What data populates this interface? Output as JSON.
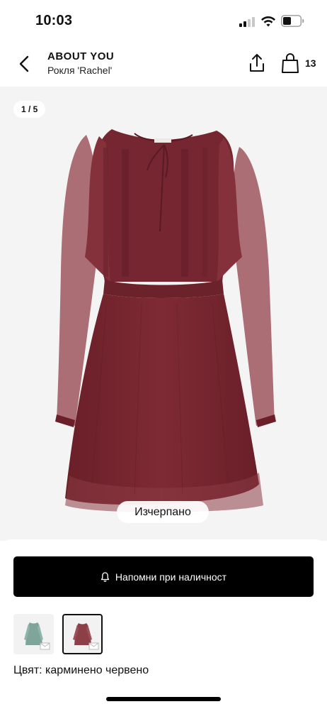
{
  "status_bar": {
    "time": "10:03"
  },
  "header": {
    "brand": "ABOUT YOU",
    "product_name": "Рокля 'Rachel'",
    "bag_count": "13",
    "icons": [
      "chevron-left-icon",
      "share-icon",
      "shopping-bag-icon"
    ]
  },
  "gallery": {
    "page_indicator": "1 / 5",
    "sold_out_label": "Изчерпано",
    "dress_color": "#7a2730"
  },
  "actions": {
    "notify_label": "Напомни при наличност",
    "notify_icon": "bell-icon"
  },
  "variants": [
    {
      "color_name": "green",
      "swatch": "#7fa59b"
    },
    {
      "color_name": "carmine red",
      "swatch": "#8c3f47"
    }
  ],
  "color_line": "Цвят: карминено червено",
  "colors": {
    "background": "#ffffff",
    "gallery_bg": "#f4f4f4",
    "primary_button": "#000000"
  }
}
